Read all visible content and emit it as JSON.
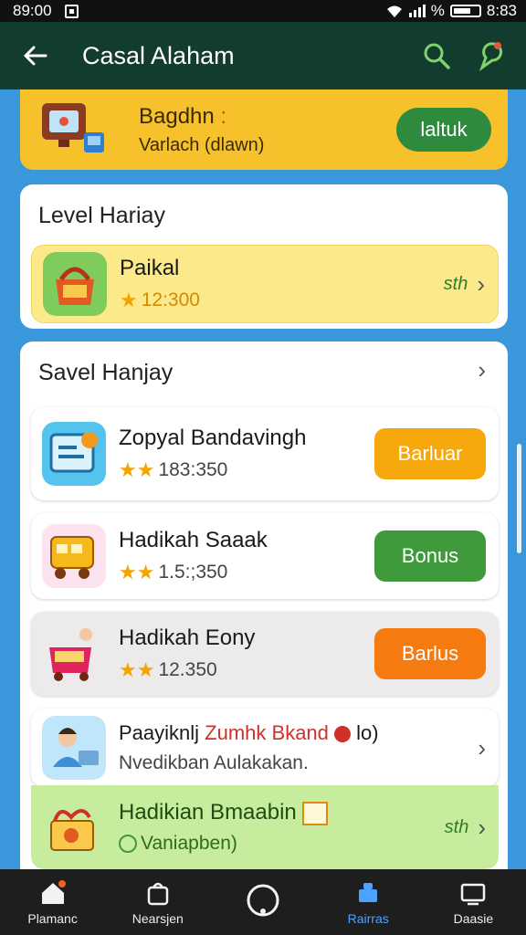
{
  "status": {
    "time": "89:00",
    "right_text": "%",
    "right_time": "8:83"
  },
  "appbar": {
    "title": "Casal Alaham"
  },
  "banner": {
    "title": "Bagdhn",
    "title_suffix": ":",
    "subtitle": "Varlach (dlawn)",
    "button": "laltuk"
  },
  "level_section": {
    "title": "Level Hariay",
    "item": {
      "name": "Paikal",
      "rating_stars": "★",
      "rating": "12:300",
      "action": "sth"
    }
  },
  "saved_section": {
    "title": "Savel Hanjay",
    "items": [
      {
        "name": "Zopyal Bandavingh",
        "stars": "★★",
        "value": "183:350",
        "button": "Barluar",
        "button_color": "#f7a80c"
      },
      {
        "name": "Hadikah Saaak",
        "stars": "★★",
        "value": "1.5:;350",
        "button": "Bonus",
        "button_color": "#3f9a3b"
      },
      {
        "name": "Hadikah Eony",
        "stars": "★★",
        "value": "12.350",
        "button": "Barlus",
        "button_color": "#f57a10"
      }
    ],
    "promo": {
      "name_a": "Paayiknlj",
      "name_b": "Zumhk Bkand",
      "name_c": "lo)",
      "sub": "Nvedikban Aulakakan."
    },
    "last": {
      "name": "Hadikian Bmaabin",
      "sub": "Vaniapben)",
      "action": "sth"
    }
  },
  "bottom_nav": [
    {
      "label": "Plamanc",
      "icon": "home-icon"
    },
    {
      "label": "Nearsjen",
      "icon": "bag-icon"
    },
    {
      "label": "",
      "icon": "circle-icon"
    },
    {
      "label": "Rairras",
      "icon": "store-icon",
      "active": true
    },
    {
      "label": "Daasie",
      "icon": "tv-icon"
    }
  ]
}
